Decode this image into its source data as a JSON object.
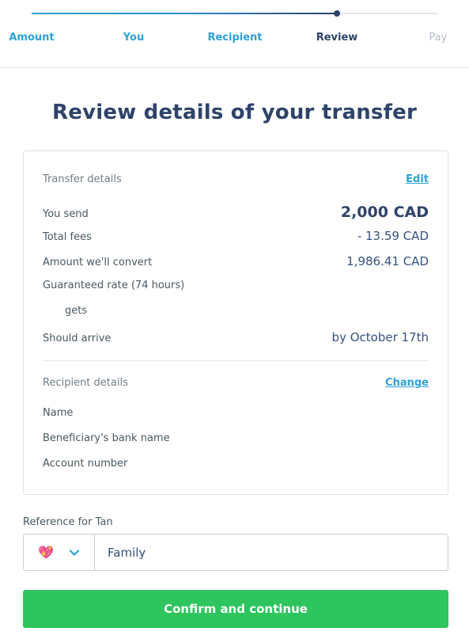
{
  "stepper": {
    "steps": [
      "Amount",
      "You",
      "Recipient",
      "Review",
      "Pay"
    ]
  },
  "title": "Review details of your transfer",
  "transfer": {
    "section_title": "Transfer details",
    "edit_label": "Edit",
    "you_send_label": "You send",
    "you_send_value": "2,000 CAD",
    "fees_label": "Total fees",
    "fees_value": "- 13.59 CAD",
    "convert_label": "Amount we'll convert",
    "convert_value": "1,986.41 CAD",
    "rate_label": "Guaranteed rate (74 hours)",
    "gets_label": "gets",
    "arrive_label": "Should arrive",
    "arrive_value": "by October 17th"
  },
  "recipient": {
    "section_title": "Recipient details",
    "change_label": "Change",
    "name_label": "Name",
    "bank_label": "Beneficiary's bank name",
    "account_label": "Account number"
  },
  "reference": {
    "label": "Reference for Tan",
    "emoji": "💖",
    "value": "Family"
  },
  "confirm_label": "Confirm and continue",
  "colors": {
    "accent": "#2ea1d9",
    "navy": "#2e4369",
    "confirm": "#2ec45e"
  }
}
